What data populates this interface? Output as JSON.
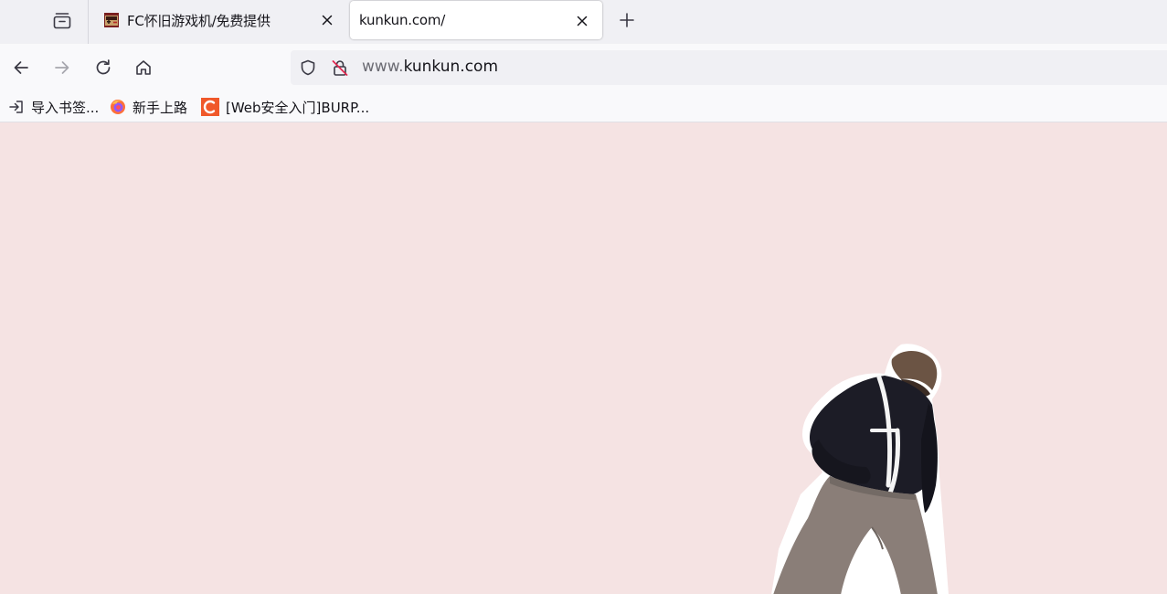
{
  "tabs": [
    {
      "title": "FC怀旧游戏机/免费提供",
      "active": false,
      "icon": "nes-game-favicon"
    },
    {
      "title": "kunkun.com/",
      "active": true,
      "icon": "none"
    }
  ],
  "navbar": {
    "url_prefix": "www.",
    "url_domain": "kunkun.com"
  },
  "bookmarks": [
    {
      "label": "导入书签...",
      "icon": "import-icon"
    },
    {
      "label": "新手上路",
      "icon": "firefox-icon"
    },
    {
      "label": "[Web安全入门]BURP...",
      "icon": "c-logo-icon"
    }
  ],
  "colors": {
    "page_background": "#f5e3e3",
    "tabstrip": "#f0f0f4",
    "active_tab": "#ffffff",
    "c_logo": "#f0582a"
  }
}
